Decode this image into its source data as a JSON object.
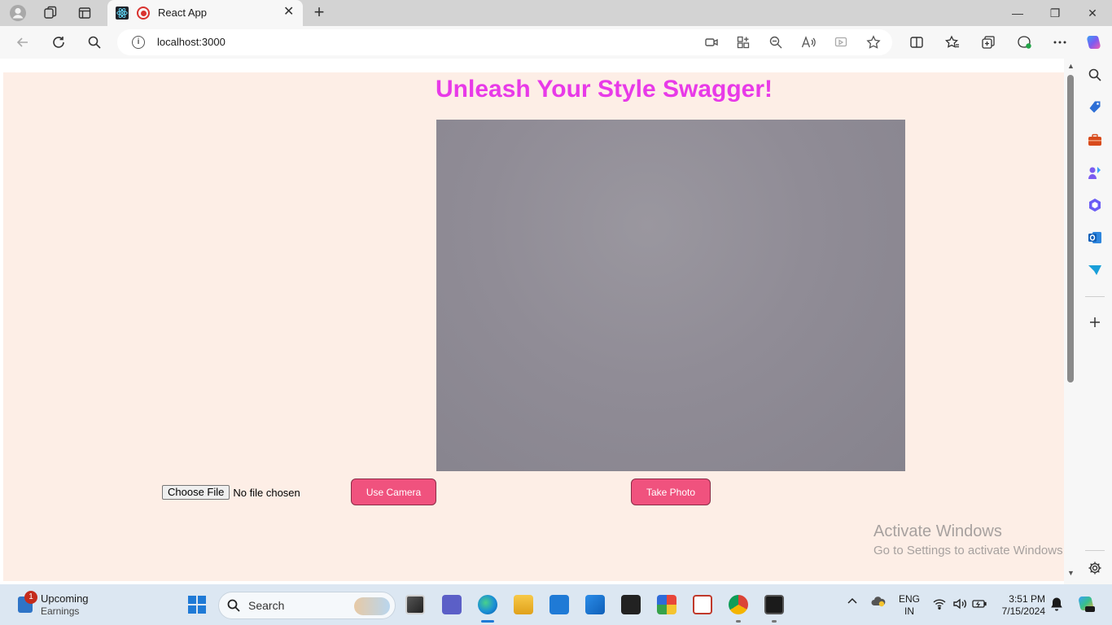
{
  "browser": {
    "tab": {
      "title": "React App",
      "close_glyph": "✕"
    },
    "new_tab_glyph": "+",
    "address": {
      "url": "localhost:3000",
      "info_glyph": "i"
    },
    "window_controls": {
      "minimize": "—",
      "restore": "❐",
      "close": "✕"
    }
  },
  "page": {
    "heading": "Unleash Your Style Swagger!",
    "file_input": {
      "button_label": "Choose File",
      "status": "No file chosen"
    },
    "use_camera_label": "Use Camera",
    "take_photo_label": "Take Photo",
    "colors": {
      "heading": "#e83ae8",
      "button": "#f0527e",
      "background": "#fdeee6"
    }
  },
  "watermark": {
    "line1": "Activate Windows",
    "line2": "Go to Settings to activate Windows."
  },
  "taskbar": {
    "widget": {
      "badge": "1",
      "title": "Upcoming",
      "subtitle": "Earnings"
    },
    "search_label": "Search",
    "language": {
      "line1": "ENG",
      "line2": "IN"
    },
    "clock": {
      "time": "3:51 PM",
      "date": "7/15/2024"
    }
  }
}
